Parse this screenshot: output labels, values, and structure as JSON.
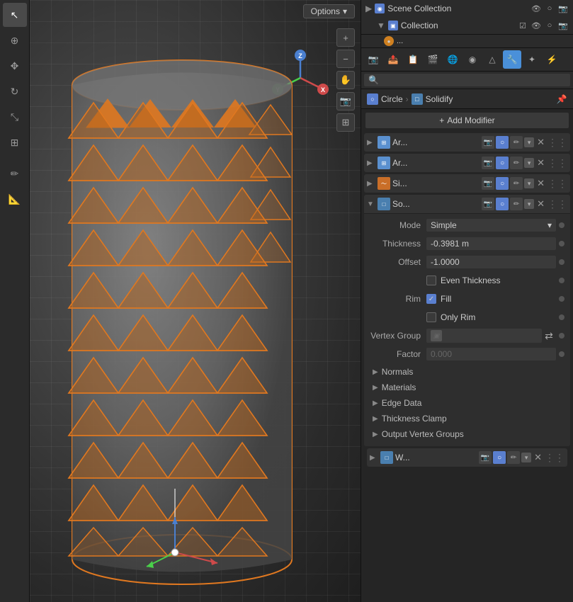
{
  "scene": {
    "collection_label": "Scene Collection",
    "sub_collection_label": "Collection"
  },
  "viewport": {
    "options_label": "Options"
  },
  "breadcrumb": {
    "object_name": "Circle",
    "modifier_name": "Solidify"
  },
  "add_modifier": {
    "label": "Add Modifier",
    "plus_icon": "+"
  },
  "modifiers": [
    {
      "id": "mod1",
      "name": "Ar...",
      "expanded": false,
      "icon_type": "array"
    },
    {
      "id": "mod2",
      "name": "Ar...",
      "expanded": false,
      "icon_type": "array"
    },
    {
      "id": "mod3",
      "name": "Si...",
      "expanded": false,
      "icon_type": "simple_deform"
    },
    {
      "id": "mod4",
      "name": "So...",
      "expanded": true,
      "icon_type": "solidify"
    }
  ],
  "solidify": {
    "mode_label": "Mode",
    "mode_value": "Simple",
    "thickness_label": "Thickness",
    "thickness_value": "-0.3981 m",
    "offset_label": "Offset",
    "offset_value": "-1.0000",
    "even_thickness_label": "Even Thickness",
    "rim_label": "Rim",
    "fill_label": "Fill",
    "fill_checked": true,
    "only_rim_label": "Only Rim",
    "vertex_group_label": "Vertex Group",
    "factor_label": "Factor",
    "factor_value": "0.000",
    "normals_label": "Normals",
    "materials_label": "Materials",
    "edge_data_label": "Edge Data",
    "thickness_clamp_label": "Thickness Clamp",
    "output_vertex_groups_label": "Output Vertex Groups"
  },
  "bottom_modifier": {
    "name": "W..."
  },
  "icons": {
    "search": "🔍",
    "options_arrow": "▾",
    "magnify": "🔍",
    "hand": "✋",
    "camera": "📷",
    "grid": "⊞",
    "scene": "🎬",
    "object": "◉",
    "mesh": "△",
    "material": "●",
    "wrench": "🔧",
    "particles": "✦",
    "physics": "⚡",
    "constraints": "🔗",
    "data": "📊",
    "shader": "🎨",
    "world": "🌐",
    "render": "📷",
    "output": "📤",
    "view_layer": "📋",
    "scene_props": "🎬"
  }
}
